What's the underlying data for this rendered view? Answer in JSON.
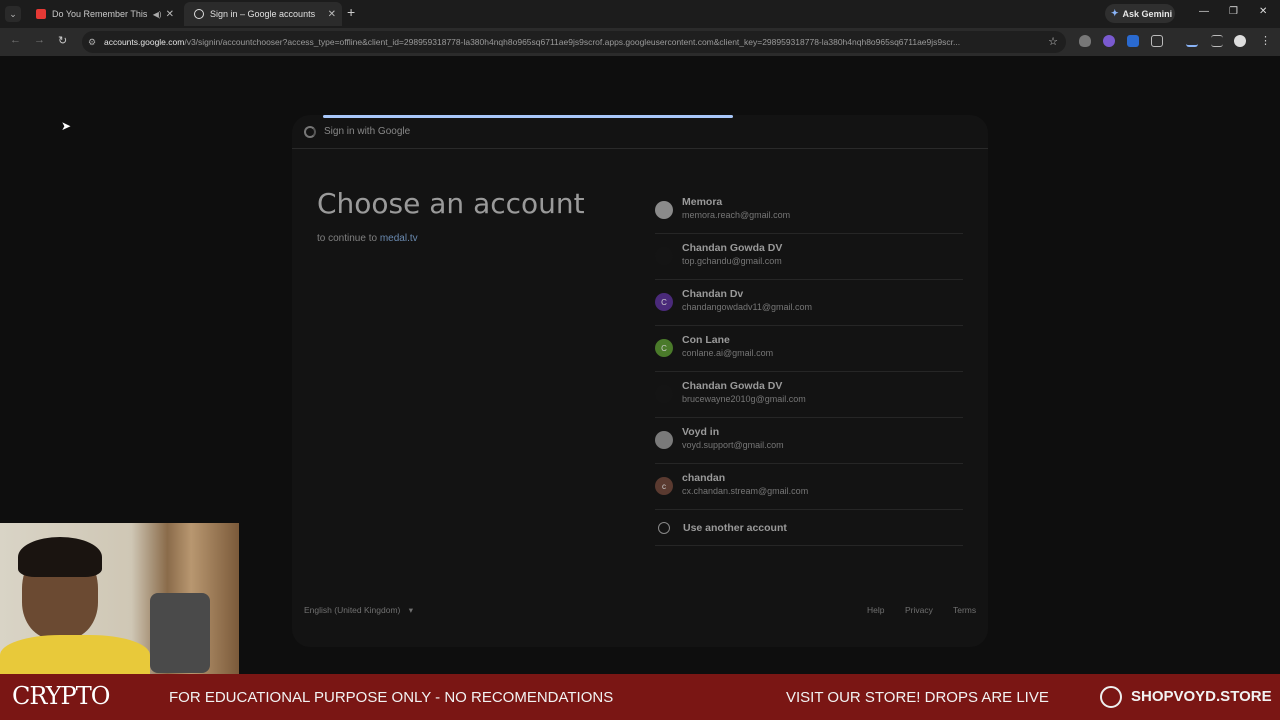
{
  "browser": {
    "tabs": [
      {
        "title": "Do You Remember This Mo",
        "icon": "youtube-icon",
        "audio": true
      },
      {
        "title": "Sign in – Google accounts",
        "icon": "google-icon",
        "active": true
      }
    ],
    "gemini_label": "Ask Gemini",
    "url_host": "accounts.google.com",
    "url_rest": "/v3/signin/accountchooser?access_type=offline&client_id=298959318778-la380h4nqh8o965sq6711ae9js9scrof.apps.googleusercontent.com&client_key=298959318778-la380h4nqh8o965sq6711ae9js9scr..."
  },
  "signin": {
    "header": "Sign in with Google",
    "heading": "Choose an account",
    "continue_prefix": "to continue to",
    "continue_site": "medal.tv",
    "accounts": [
      {
        "name": "Memora",
        "email": "memora.reach@gmail.com",
        "avatar_color": "#8a8a8a",
        "initial": ""
      },
      {
        "name": "Chandan Gowda DV",
        "email": "top.gchandu@gmail.com",
        "avatar_color": "#141414",
        "initial": ""
      },
      {
        "name": "Chandan Dv",
        "email": "chandangowdadv11@gmail.com",
        "avatar_color": "#4a2a7a",
        "initial": "C"
      },
      {
        "name": "Con Lane",
        "email": "conlane.ai@gmail.com",
        "avatar_color": "#4a7a2a",
        "initial": "C"
      },
      {
        "name": "Chandan Gowda DV",
        "email": "brucewayne2010g@gmail.com",
        "avatar_color": "#141414",
        "initial": ""
      },
      {
        "name": "Voyd in",
        "email": "voyd.support@gmail.com",
        "avatar_color": "#7a7a7a",
        "initial": ""
      },
      {
        "name": "chandan",
        "email": "cx.chandan.stream@gmail.com",
        "avatar_color": "#5a3a30",
        "initial": "c"
      }
    ],
    "use_another": "Use another account",
    "footer": {
      "language": "English (United Kingdom)",
      "help": "Help",
      "privacy": "Privacy",
      "terms": "Terms"
    }
  },
  "banner": {
    "brand": "CRYPTO",
    "message1": "FOR EDUCATIONAL PURPOSE ONLY - NO RECOMENDATIONS",
    "message2": "VISIT OUR STORE! DROPS ARE LIVE",
    "store": "SHOPVOYD.STORE"
  }
}
